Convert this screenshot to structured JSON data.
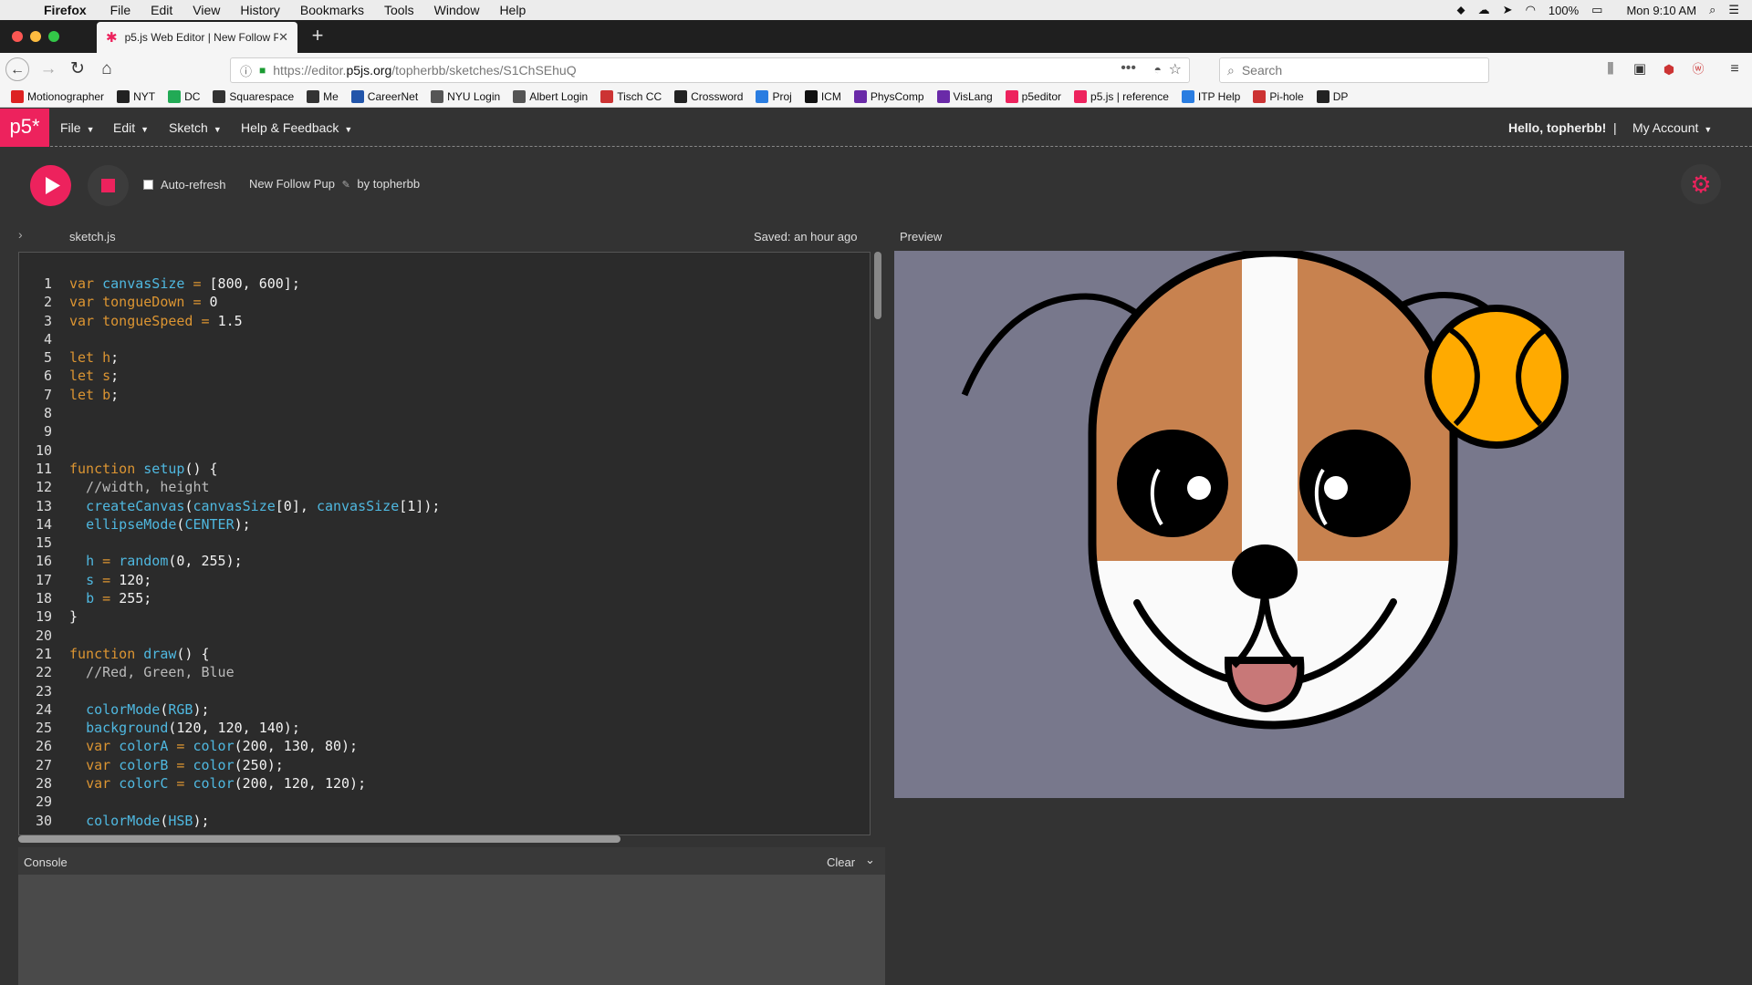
{
  "mac_menubar": {
    "app_name": "Firefox",
    "menus": [
      "File",
      "Edit",
      "View",
      "History",
      "Bookmarks",
      "Tools",
      "Window",
      "Help"
    ],
    "battery": "100%",
    "clock": "Mon 9:10 AM"
  },
  "browser": {
    "tab_title": "p5.js Web Editor | New Follow P",
    "url": "https://editor.p5js.org/topherbb/sketches/S1ChSEhuQ",
    "url_prefix": "https://editor.",
    "url_domain": "p5js.org",
    "url_path": "/topherbb/sketches/S1ChSEhuQ",
    "search_placeholder": "Search"
  },
  "bookmarks": [
    {
      "label": "Motionographer",
      "icon": "motionographer-icon",
      "color": "#d22"
    },
    {
      "label": "NYT",
      "icon": "nyt-icon",
      "color": "#222"
    },
    {
      "label": "DC",
      "icon": "dc-icon",
      "color": "#2a5"
    },
    {
      "label": "Squarespace",
      "icon": "squarespace-icon",
      "color": "#333"
    },
    {
      "label": "Me",
      "icon": "me-icon",
      "color": "#333"
    },
    {
      "label": "CareerNet",
      "icon": "careernet-icon",
      "color": "#2255aa"
    },
    {
      "label": "NYU Login",
      "icon": "globe-icon",
      "color": "#555"
    },
    {
      "label": "Albert Login",
      "icon": "globe-icon",
      "color": "#555"
    },
    {
      "label": "Tisch CC",
      "icon": "tisch-icon",
      "color": "#c33"
    },
    {
      "label": "Crossword",
      "icon": "nyt-icon",
      "color": "#222"
    },
    {
      "label": "Proj",
      "icon": "dropbox-icon",
      "color": "#2a7de1"
    },
    {
      "label": "ICM",
      "icon": "github-icon",
      "color": "#111"
    },
    {
      "label": "PhysComp",
      "icon": "itp-icon",
      "color": "#6a2aa8"
    },
    {
      "label": "VisLang",
      "icon": "itp-icon",
      "color": "#6a2aa8"
    },
    {
      "label": "p5editor",
      "icon": "p5-star-icon",
      "color": "#ed225d"
    },
    {
      "label": "p5.js | reference",
      "icon": "p5-star-icon",
      "color": "#ed225d"
    },
    {
      "label": "ITP Help",
      "icon": "itp-help-icon",
      "color": "#2a7de1"
    },
    {
      "label": "Pi-hole",
      "icon": "pihole-icon",
      "color": "#c33"
    },
    {
      "label": "DP",
      "icon": "dp-icon",
      "color": "#222"
    }
  ],
  "p5_nav": {
    "logo": "p5*",
    "menus": [
      "File",
      "Edit",
      "Sketch",
      "Help & Feedback"
    ],
    "greeting": "Hello, topherbb!",
    "separator": "|",
    "account": "My Account"
  },
  "toolbar": {
    "auto_refresh_label": "Auto-refresh",
    "sketch_name": "New Follow Pup",
    "by_author": "by topherbb"
  },
  "editor": {
    "file_name": "sketch.js",
    "saved_status": "Saved: an hour ago",
    "active_line": 1,
    "lines": [
      [
        {
          "t": "var ",
          "c": "k"
        },
        {
          "t": "canvasSize",
          "c": "f"
        },
        {
          "t": " = ",
          "c": "k"
        },
        {
          "t": "[800, 600];",
          "c": ""
        }
      ],
      [
        {
          "t": "var ",
          "c": "k"
        },
        {
          "t": "tongueDown",
          "c": "k"
        },
        {
          "t": " = ",
          "c": "k"
        },
        {
          "t": "0",
          "c": ""
        }
      ],
      [
        {
          "t": "var ",
          "c": "k"
        },
        {
          "t": "tongueSpeed",
          "c": "k"
        },
        {
          "t": " = ",
          "c": "k"
        },
        {
          "t": "1.5",
          "c": ""
        }
      ],
      [],
      [
        {
          "t": "let ",
          "c": "k"
        },
        {
          "t": "h",
          "c": "k"
        },
        {
          "t": ";",
          "c": ""
        }
      ],
      [
        {
          "t": "let ",
          "c": "k"
        },
        {
          "t": "s",
          "c": "k"
        },
        {
          "t": ";",
          "c": ""
        }
      ],
      [
        {
          "t": "let ",
          "c": "k"
        },
        {
          "t": "b",
          "c": "k"
        },
        {
          "t": ";",
          "c": ""
        }
      ],
      [],
      [],
      [],
      [
        {
          "t": "function ",
          "c": "k"
        },
        {
          "t": "setup",
          "c": "f"
        },
        {
          "t": "() {",
          "c": ""
        }
      ],
      [
        {
          "t": "  //width, height",
          "c": "c"
        }
      ],
      [
        {
          "t": "  ",
          "c": ""
        },
        {
          "t": "createCanvas",
          "c": "f"
        },
        {
          "t": "(",
          "c": ""
        },
        {
          "t": "canvasSize",
          "c": "f"
        },
        {
          "t": "[0], ",
          "c": ""
        },
        {
          "t": "canvasSize",
          "c": "f"
        },
        {
          "t": "[1]);",
          "c": ""
        }
      ],
      [
        {
          "t": "  ",
          "c": ""
        },
        {
          "t": "ellipseMode",
          "c": "f"
        },
        {
          "t": "(",
          "c": ""
        },
        {
          "t": "CENTER",
          "c": "f"
        },
        {
          "t": ");",
          "c": ""
        }
      ],
      [],
      [
        {
          "t": "  ",
          "c": ""
        },
        {
          "t": "h",
          "c": "f"
        },
        {
          "t": " = ",
          "c": "k"
        },
        {
          "t": "random",
          "c": "f"
        },
        {
          "t": "(0, 255);",
          "c": ""
        }
      ],
      [
        {
          "t": "  ",
          "c": ""
        },
        {
          "t": "s",
          "c": "f"
        },
        {
          "t": " = ",
          "c": "k"
        },
        {
          "t": "120;",
          "c": ""
        }
      ],
      [
        {
          "t": "  ",
          "c": ""
        },
        {
          "t": "b",
          "c": "f"
        },
        {
          "t": " = ",
          "c": "k"
        },
        {
          "t": "255;",
          "c": ""
        }
      ],
      [
        {
          "t": "}",
          "c": ""
        }
      ],
      [],
      [
        {
          "t": "function ",
          "c": "k"
        },
        {
          "t": "draw",
          "c": "f"
        },
        {
          "t": "() {",
          "c": ""
        }
      ],
      [
        {
          "t": "  //Red, Green, Blue",
          "c": "c"
        }
      ],
      [],
      [
        {
          "t": "  ",
          "c": ""
        },
        {
          "t": "colorMode",
          "c": "f"
        },
        {
          "t": "(",
          "c": ""
        },
        {
          "t": "RGB",
          "c": "f"
        },
        {
          "t": ");",
          "c": ""
        }
      ],
      [
        {
          "t": "  ",
          "c": ""
        },
        {
          "t": "background",
          "c": "f"
        },
        {
          "t": "(120, 120, 140);",
          "c": ""
        }
      ],
      [
        {
          "t": "  ",
          "c": ""
        },
        {
          "t": "var ",
          "c": "k"
        },
        {
          "t": "colorA",
          "c": "f"
        },
        {
          "t": " = ",
          "c": "k"
        },
        {
          "t": "color",
          "c": "f"
        },
        {
          "t": "(200, 130, 80);",
          "c": ""
        }
      ],
      [
        {
          "t": "  ",
          "c": ""
        },
        {
          "t": "var ",
          "c": "k"
        },
        {
          "t": "colorB",
          "c": "f"
        },
        {
          "t": " = ",
          "c": "k"
        },
        {
          "t": "color",
          "c": "f"
        },
        {
          "t": "(250);",
          "c": ""
        }
      ],
      [
        {
          "t": "  ",
          "c": ""
        },
        {
          "t": "var ",
          "c": "k"
        },
        {
          "t": "colorC",
          "c": "f"
        },
        {
          "t": " = ",
          "c": "k"
        },
        {
          "t": "color",
          "c": "f"
        },
        {
          "t": "(200, 120, 120);",
          "c": ""
        }
      ],
      [],
      [
        {
          "t": "  ",
          "c": ""
        },
        {
          "t": "colorMode",
          "c": "f"
        },
        {
          "t": "(",
          "c": ""
        },
        {
          "t": "HSB",
          "c": "f"
        },
        {
          "t": ");",
          "c": ""
        }
      ]
    ]
  },
  "console": {
    "label": "Console",
    "clear_label": "Clear"
  },
  "preview": {
    "label": "Preview",
    "background": "#78788c",
    "colors": {
      "brown": "#c8824f",
      "white": "#fafafa",
      "tongue": "#c87878",
      "ball": "#ffaa00",
      "outline": "#000000"
    }
  },
  "theme": {
    "accent": "#ed225d"
  }
}
